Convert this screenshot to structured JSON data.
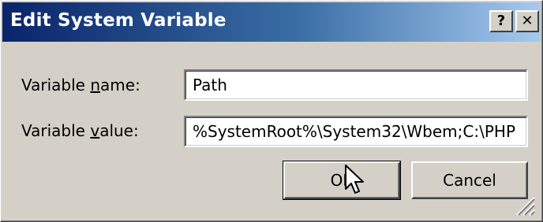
{
  "window": {
    "title": "Edit System Variable",
    "help_label": "?",
    "close_label": "✕"
  },
  "form": {
    "name_label_pre": "Variable ",
    "name_label_acc": "n",
    "name_label_post": "ame:",
    "name_value": "Path",
    "value_label_pre": "Variable ",
    "value_label_acc": "v",
    "value_label_post": "alue:",
    "value_value": "%SystemRoot%\\System32\\Wbem;C:\\PHP"
  },
  "buttons": {
    "ok_label": "OK",
    "cancel_label": "Cancel"
  },
  "icons": {
    "cursor": "mouse-pointer-icon",
    "grip": "resize-grip-icon"
  }
}
